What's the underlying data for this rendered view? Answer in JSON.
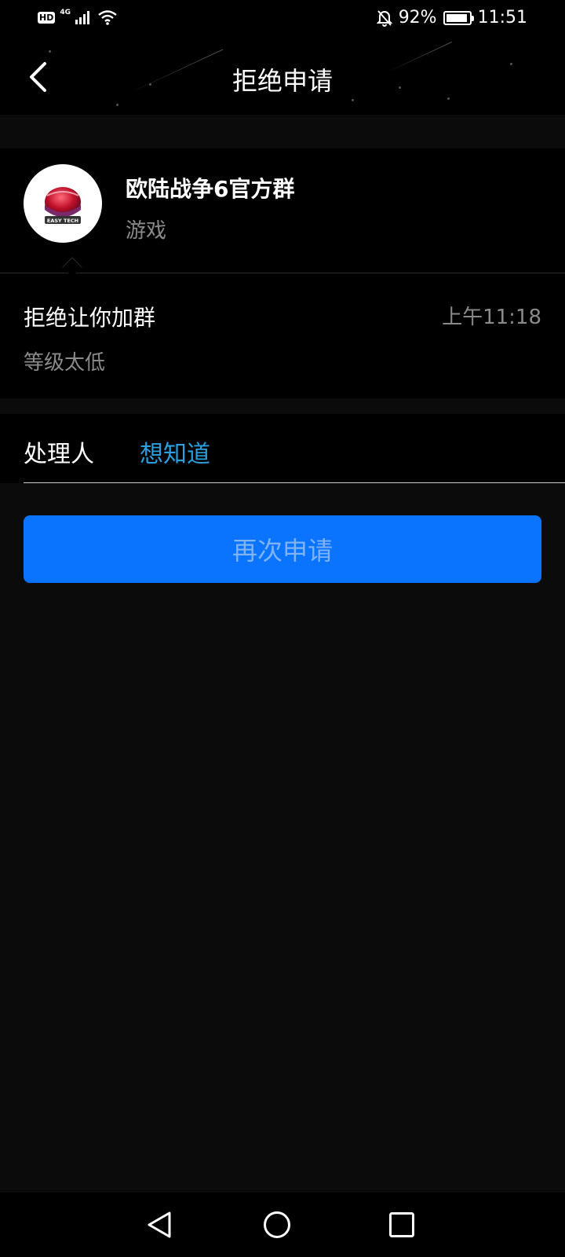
{
  "status_bar": {
    "hd_label": "HD",
    "network": "4G",
    "battery": "92%",
    "battery_level": 0.92,
    "time": "11:51"
  },
  "header": {
    "title": "拒绝申请",
    "back_icon": "chevron-left-icon"
  },
  "group": {
    "name": "欧陆战争6官方群",
    "category": "游戏",
    "avatar_text": "EASY TECH"
  },
  "rejection": {
    "title": "拒绝让你加群",
    "time": "上午11:18",
    "reason": "等级太低"
  },
  "handler": {
    "label": "处理人",
    "name": "想知道"
  },
  "actions": {
    "reapply_label": "再次申请"
  },
  "nav": {
    "back_icon": "triangle-back-icon",
    "home_icon": "circle-home-icon",
    "recents_icon": "square-recents-icon"
  },
  "colors": {
    "accent_blue": "#0a74ff",
    "link_blue": "#2aa0e0",
    "background": "#0b0b0b",
    "muted_text": "#8a8a8a"
  }
}
